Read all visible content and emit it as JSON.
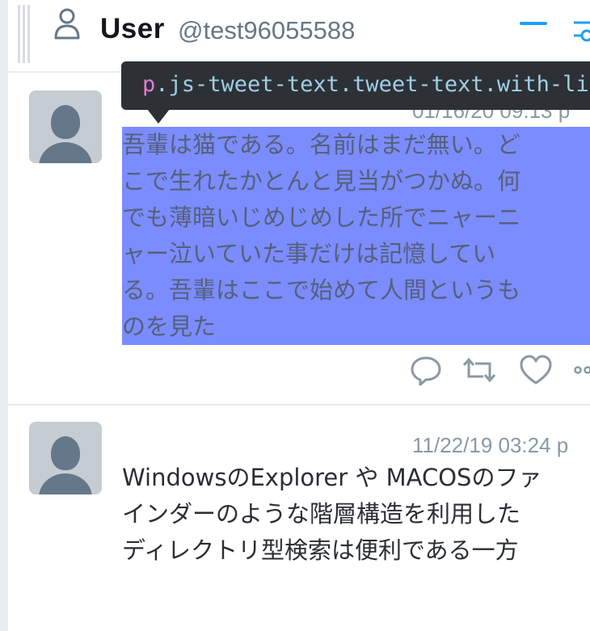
{
  "column": {
    "title": "User",
    "handle": "@test96055588",
    "icons": [
      "user-icon",
      "minus-icon",
      "filter-icon",
      "column-grip-icon"
    ]
  },
  "tooltip": {
    "tag": "p",
    "selector": ".js-tweet-text.tweet-text.with-li"
  },
  "tweets": [
    {
      "timestamp": "01/16/20 09:13 p",
      "lines": [
        "吾輩は猫である。名前はまだ無い。ど",
        "こで生れたかとんと見当がつかぬ。何",
        "でも薄暗いじめじめした所でニャーニ",
        "ャー泣いていた事だけは記憶してい",
        "る。吾輩はここで始めて人間というも",
        "のを見た"
      ],
      "selection_color": "#6a78ff",
      "actions": [
        "reply-icon",
        "retweet-icon",
        "like-icon",
        "more-icon"
      ]
    },
    {
      "timestamp": "11/22/19 03:24 p",
      "lines": [
        "WindowsのExplorer や MACOSのファ",
        "インダーのような階層構造を利用した",
        "ディレクトリ型検索は便利である一方"
      ]
    }
  ],
  "colors": {
    "accent": "#1da1f2",
    "avatar_bg": "#c5cdd3",
    "avatar_fg": "#65788a",
    "tooltip_bg": "#2d3136"
  }
}
